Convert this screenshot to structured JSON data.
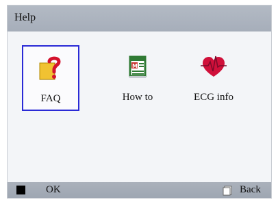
{
  "header": {
    "title": "Help"
  },
  "menu": {
    "items": [
      {
        "label": "FAQ",
        "icon": "faq-question-icon",
        "selected": true
      },
      {
        "label": "How to",
        "icon": "how-to-book-icon",
        "selected": false
      },
      {
        "label": "ECG info",
        "icon": "ecg-heart-icon",
        "selected": false
      }
    ]
  },
  "footer": {
    "ok_label": "OK",
    "back_label": "Back"
  },
  "colors": {
    "selection_border": "#2a2ad6",
    "bar_background": "#a6aeba",
    "heart_red": "#d0103a"
  }
}
